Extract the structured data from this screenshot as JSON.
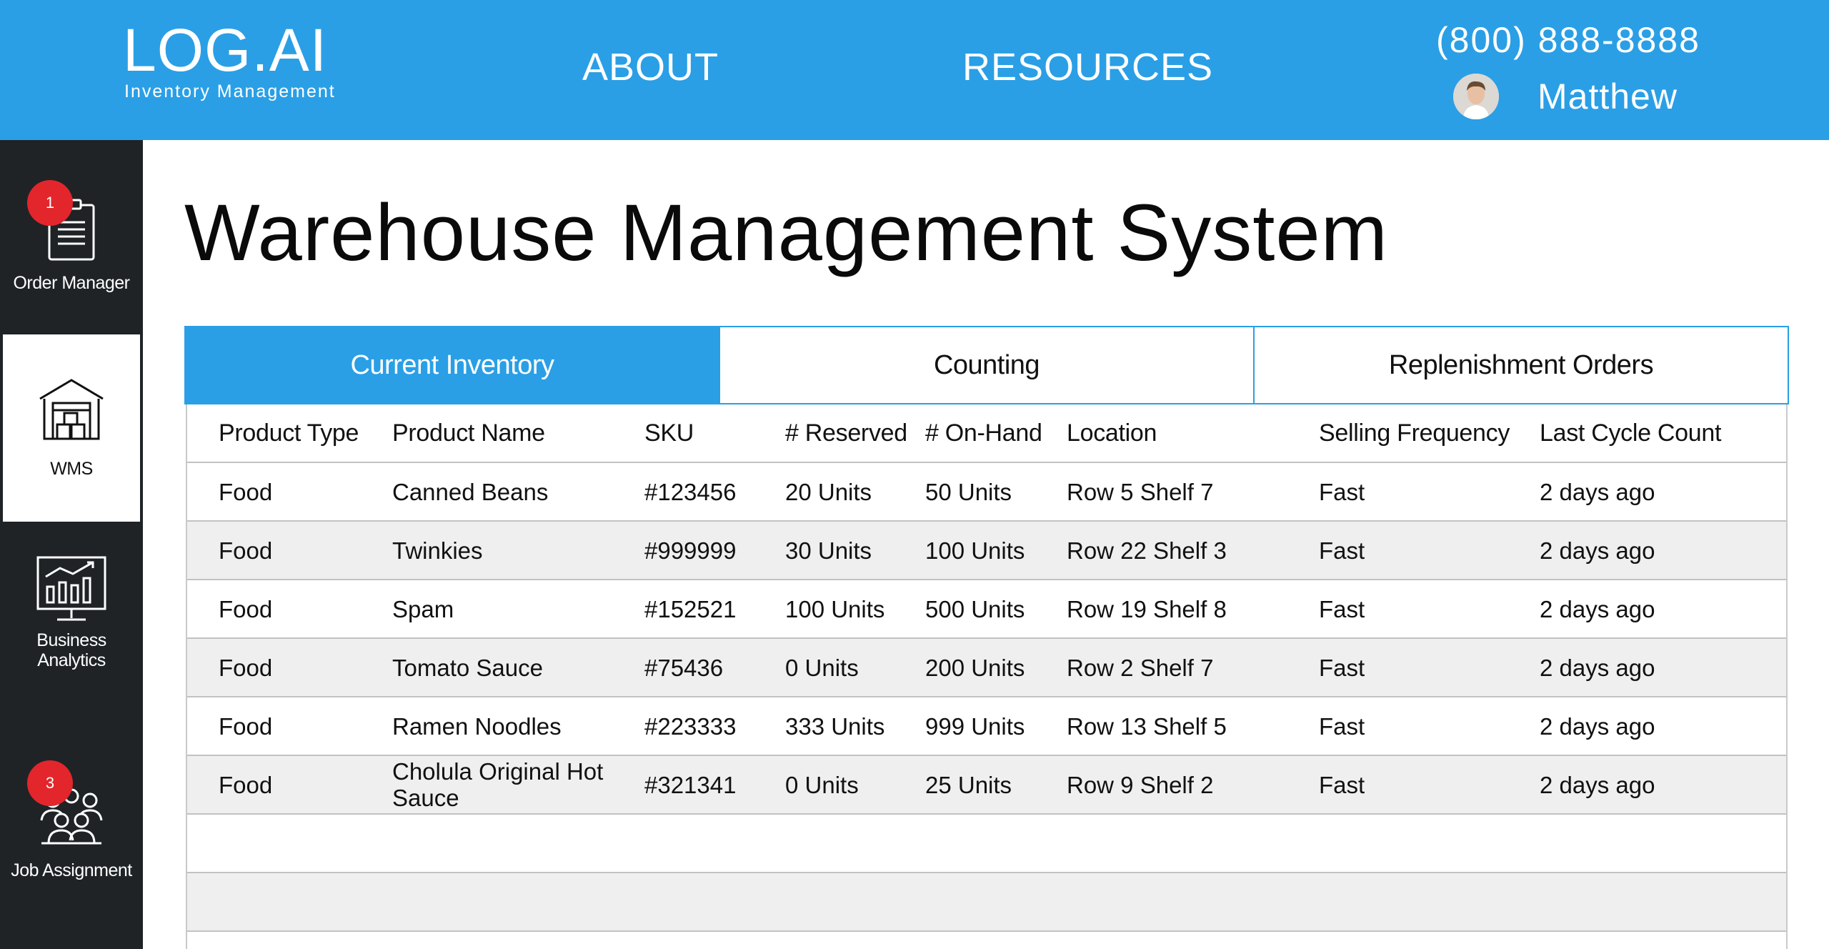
{
  "header": {
    "logo_title": "LOG.AI",
    "logo_subtitle": "Inventory Management",
    "nav": {
      "about": "ABOUT",
      "resources": "RESOURCES"
    },
    "phone": "(800) 888-8888",
    "user_name": "Matthew"
  },
  "sidebar": {
    "items": [
      {
        "label": "Order Manager",
        "badge": "1",
        "icon": "clipboard-icon"
      },
      {
        "label": "WMS",
        "icon": "warehouse-icon",
        "active": true
      },
      {
        "label": "Business Analytics",
        "icon": "analytics-monitor-icon"
      },
      {
        "label": "Job Assignment",
        "badge": "3",
        "icon": "people-group-icon"
      }
    ]
  },
  "main": {
    "title": "Warehouse Management System",
    "tabs": [
      {
        "label": "Current Inventory",
        "active": true
      },
      {
        "label": "Counting"
      },
      {
        "label": "Replenishment Orders"
      }
    ],
    "table": {
      "columns": [
        "Product Type",
        "Product Name",
        "SKU",
        "# Reserved",
        "# On-Hand",
        "Location",
        "Selling Frequency",
        "Last Cycle Count"
      ],
      "rows": [
        [
          "Food",
          "Canned Beans",
          "#123456",
          "20 Units",
          "50 Units",
          "Row 5 Shelf 7",
          "Fast",
          "2 days ago"
        ],
        [
          "Food",
          "Twinkies",
          "#999999",
          "30 Units",
          "100 Units",
          "Row 22 Shelf 3",
          "Fast",
          "2 days ago"
        ],
        [
          "Food",
          "Spam",
          "#152521",
          "100 Units",
          "500 Units",
          "Row 19 Shelf 8",
          "Fast",
          "2 days ago"
        ],
        [
          "Food",
          "Tomato Sauce",
          "#75436",
          "0 Units",
          "200 Units",
          "Row 2 Shelf 7",
          "Fast",
          "2 days ago"
        ],
        [
          "Food",
          "Ramen Noodles",
          "#223333",
          "333 Units",
          "999 Units",
          "Row 13 Shelf 5",
          "Fast",
          "2 days ago"
        ],
        [
          "Food",
          "Cholula Original Hot Sauce",
          "#321341",
          "0 Units",
          "25 Units",
          "Row 9 Shelf 2",
          "Fast",
          "2 days ago"
        ]
      ]
    }
  },
  "colors": {
    "brand_blue": "#2a9fe6",
    "sidebar_bg": "#1f2326",
    "badge_red": "#e3262b",
    "row_alt": "#efefef"
  }
}
